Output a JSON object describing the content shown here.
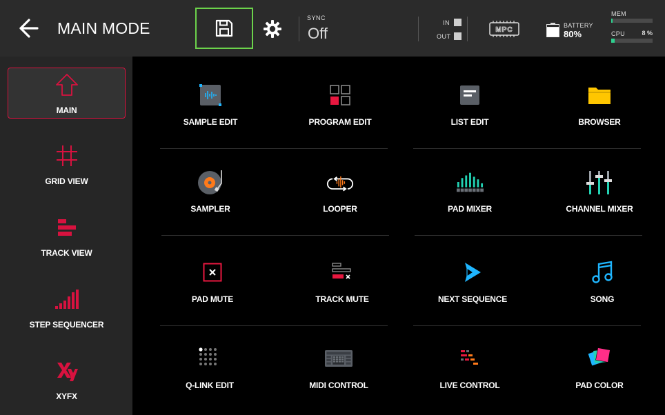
{
  "header": {
    "title": "MAIN MODE",
    "sync_label": "SYNC",
    "sync_value": "Off",
    "in_label": "IN",
    "out_label": "OUT",
    "mpc_label": "MPC",
    "battery_label": "BATTERY",
    "battery_value": "80%",
    "battery_level": 0.8,
    "mem_label": "MEM",
    "mem_level": 0.03,
    "cpu_label": "CPU",
    "cpu_value": "8 %",
    "cpu_level": 0.08,
    "accent_color": "#6cd34b"
  },
  "sidebar": {
    "items": [
      {
        "label": "MAIN",
        "icon": "house-arrow-icon",
        "active": true
      },
      {
        "label": "GRID VIEW",
        "icon": "grid-hash-icon",
        "active": false
      },
      {
        "label": "TRACK VIEW",
        "icon": "track-bars-icon",
        "active": false
      },
      {
        "label": "STEP SEQUENCER",
        "icon": "step-sequencer-icon",
        "active": false
      },
      {
        "label": "XYFX",
        "icon": "xyfx-icon",
        "active": false
      }
    ],
    "active_color": "#d8123f"
  },
  "grid": {
    "tiles": [
      {
        "label": "SAMPLE EDIT",
        "icon": "waveform-icon"
      },
      {
        "label": "PROGRAM EDIT",
        "icon": "program-grid-icon"
      },
      {
        "label": "LIST EDIT",
        "icon": "list-icon"
      },
      {
        "label": "BROWSER",
        "icon": "folder-icon"
      },
      {
        "label": "SAMPLER",
        "icon": "turntable-icon"
      },
      {
        "label": "LOOPER",
        "icon": "loop-icon"
      },
      {
        "label": "PAD MIXER",
        "icon": "level-meter-icon"
      },
      {
        "label": "CHANNEL MIXER",
        "icon": "faders-icon"
      },
      {
        "label": "PAD MUTE",
        "icon": "pad-mute-icon"
      },
      {
        "label": "TRACK MUTE",
        "icon": "track-mute-icon"
      },
      {
        "label": "NEXT SEQUENCE",
        "icon": "next-sequence-icon"
      },
      {
        "label": "SONG",
        "icon": "music-note-icon"
      },
      {
        "label": "Q-LINK EDIT",
        "icon": "qlink-dots-icon"
      },
      {
        "label": "MIDI CONTROL",
        "icon": "midi-controller-icon"
      },
      {
        "label": "LIVE CONTROL",
        "icon": "live-control-icon"
      },
      {
        "label": "PAD COLOR",
        "icon": "color-swatches-icon"
      }
    ]
  }
}
